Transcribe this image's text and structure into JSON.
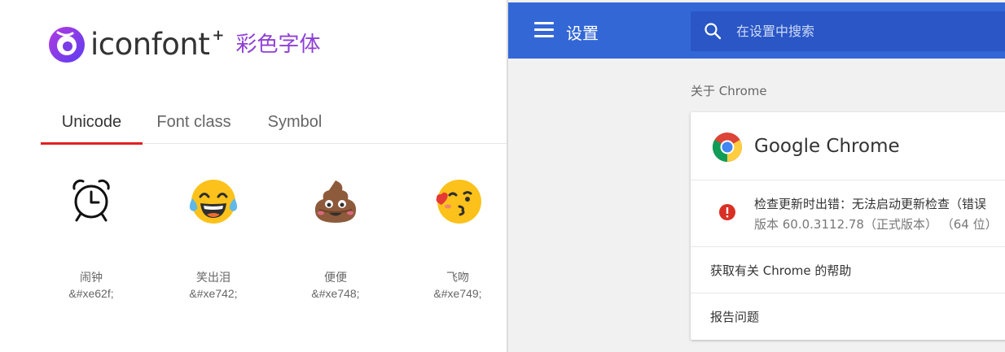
{
  "iconfont": {
    "logo_text": "iconfont",
    "logo_plus": "+",
    "logo_subtitle": "彩色字体",
    "tabs": [
      {
        "label": "Unicode",
        "active": true
      },
      {
        "label": "Font class",
        "active": false
      },
      {
        "label": "Symbol",
        "active": false
      }
    ],
    "icons": [
      {
        "name": "闹钟",
        "code": "&#xe62f;",
        "icon": "alarm-clock-icon"
      },
      {
        "name": "笑出泪",
        "code": "&#xe742;",
        "icon": "tears-of-joy-emoji-icon"
      },
      {
        "name": "便便",
        "code": "&#xe748;",
        "icon": "poop-emoji-icon"
      },
      {
        "name": "飞吻",
        "code": "&#xe749;",
        "icon": "blowing-kiss-emoji-icon"
      }
    ],
    "colors": {
      "accent": "#e02020",
      "brand_purple": "#8e3fd6"
    }
  },
  "chrome": {
    "title": "设置",
    "search_placeholder": "在设置中搜索",
    "section_title": "关于 Chrome",
    "product_name": "Google Chrome",
    "update_message": "检查更新时出错：无法启动更新检查（错误",
    "version": "版本 60.0.3112.78（正式版本）  （64 位）",
    "help_link": "获取有关 Chrome 的帮助",
    "report_link": "报告问题",
    "colors": {
      "toolbar": "#3367d6",
      "search_bg": "#2a56c6",
      "error": "#d93025"
    }
  }
}
